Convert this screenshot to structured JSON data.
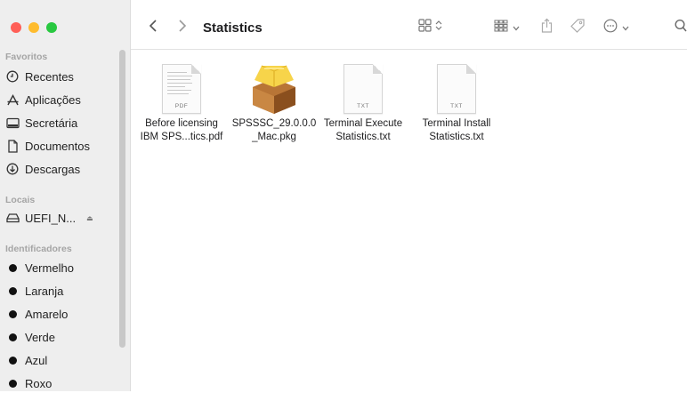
{
  "window": {
    "title": "Statistics",
    "traffic_colors": {
      "close": "#ff5f57",
      "minimize": "#febc2e",
      "zoom": "#28c840"
    }
  },
  "sidebar": {
    "favorites_title": "Favoritos",
    "favorites": [
      {
        "label": "Recentes",
        "icon": "clock-icon"
      },
      {
        "label": "Aplicações",
        "icon": "applications-icon"
      },
      {
        "label": "Secretária",
        "icon": "desktop-icon"
      },
      {
        "label": "Documentos",
        "icon": "document-icon"
      },
      {
        "label": "Descargas",
        "icon": "download-icon"
      }
    ],
    "locations_title": "Locais",
    "locations": [
      {
        "label": "UEFI_N...",
        "icon": "drive-icon"
      }
    ],
    "tags_title": "Identificadores",
    "tags": [
      {
        "label": "Vermelho"
      },
      {
        "label": "Laranja"
      },
      {
        "label": "Amarelo"
      },
      {
        "label": "Verde"
      },
      {
        "label": "Azul"
      },
      {
        "label": "Roxo"
      }
    ]
  },
  "files": [
    {
      "name_line1": "Before licensing",
      "name_line2": "IBM SPS...tics.pdf",
      "type": "PDF"
    },
    {
      "name_line1": "SPSSSC_29.0.0.0",
      "name_line2": "_Mac.pkg",
      "type": "package"
    },
    {
      "name_line1": "Terminal Execute",
      "name_line2": "Statistics.txt",
      "type": "TXT"
    },
    {
      "name_line1": "Terminal Install",
      "name_line2": "Statistics.txt",
      "type": "TXT"
    }
  ]
}
